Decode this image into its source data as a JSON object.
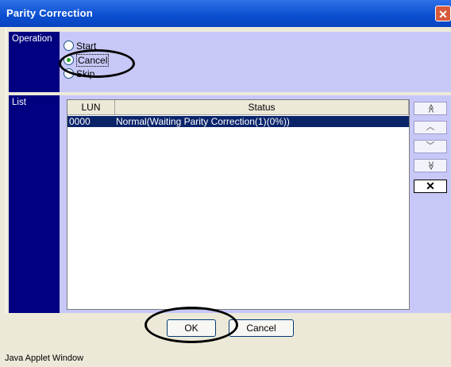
{
  "window": {
    "title": "Parity Correction",
    "close_glyph": "✕",
    "footer": "Java Applet Window"
  },
  "operation": {
    "label": "Operation",
    "options": [
      {
        "label": "Start",
        "selected": false
      },
      {
        "label": "Cancel",
        "selected": true
      },
      {
        "label": "Skip",
        "selected": false
      }
    ]
  },
  "list": {
    "label": "List",
    "columns": [
      "LUN",
      "Status"
    ],
    "rows": [
      {
        "lun": "0000",
        "status": "Normal(Waiting Parity Correction(1)(0%))",
        "selected": true
      }
    ]
  },
  "side_buttons": {
    "top": "≪",
    "up": "︿",
    "down": "﹀",
    "bottom": "≫",
    "remove": "✕"
  },
  "buttons": {
    "ok": "OK",
    "cancel": "Cancel"
  },
  "colors": {
    "title_bar": "#0a4ecf",
    "label_column": "#000080",
    "panel_bg": "#c8c8f8",
    "selection": "#0a246a"
  }
}
